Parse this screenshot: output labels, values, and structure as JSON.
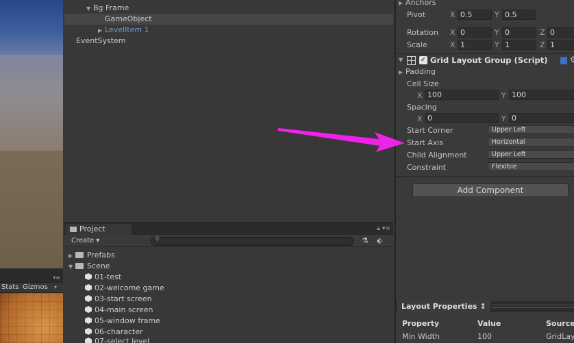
{
  "scene_panel": {
    "stats_label": "Stats",
    "gizmos_label": "Gizmos"
  },
  "hierarchy": {
    "items": [
      {
        "label": "Bg Frame",
        "expanded": true
      },
      {
        "label": "GameObject",
        "selected": true
      },
      {
        "label": "LevelItem 1",
        "collapsed": true
      },
      {
        "label": "EventSystem"
      }
    ]
  },
  "project": {
    "tab_label": "Project",
    "create_label": "Create",
    "folders": [
      {
        "label": "Prefabs"
      },
      {
        "label": "Scene"
      }
    ],
    "scenes": [
      "01-test",
      "02-welcome game",
      "03-start screen",
      "04-main screen",
      "05-window frame",
      "06-character",
      "07-select level"
    ]
  },
  "inspector": {
    "anchors_label": "Anchors",
    "pivot": {
      "label": "Pivot",
      "x": "0.5",
      "y": "0.5"
    },
    "rotation": {
      "label": "Rotation",
      "x": "0",
      "y": "0",
      "z": "0"
    },
    "scale": {
      "label": "Scale",
      "x": "1",
      "y": "1",
      "z": "1"
    },
    "axis_x": "X",
    "axis_y": "Y",
    "axis_z": "Z",
    "component_title": "Grid Layout Group (Script)",
    "checkbox_mark": "✓",
    "padding_label": "Padding",
    "cell_size": {
      "label": "Cell Size",
      "x": "100",
      "y": "100"
    },
    "spacing": {
      "label": "Spacing",
      "x": "0",
      "y": "0"
    },
    "start_corner": {
      "label": "Start Corner",
      "value": "Upper Left"
    },
    "start_axis": {
      "label": "Start Axis",
      "value": "Horizontal"
    },
    "child_alignment": {
      "label": "Child Alignment",
      "value": "Upper Left"
    },
    "constraint": {
      "label": "Constraint",
      "value": "Flexible"
    },
    "add_component_label": "Add Component",
    "layout_properties": {
      "tab_label": "Layout Properties",
      "tab_arrow": "↕",
      "columns": [
        "Property",
        "Value",
        "Source"
      ],
      "row": [
        "Min Width",
        "100",
        "GridLay"
      ]
    }
  },
  "colors": {
    "annotation_arrow": "#ee22e8",
    "prefab_text": "#6e9bd6"
  }
}
